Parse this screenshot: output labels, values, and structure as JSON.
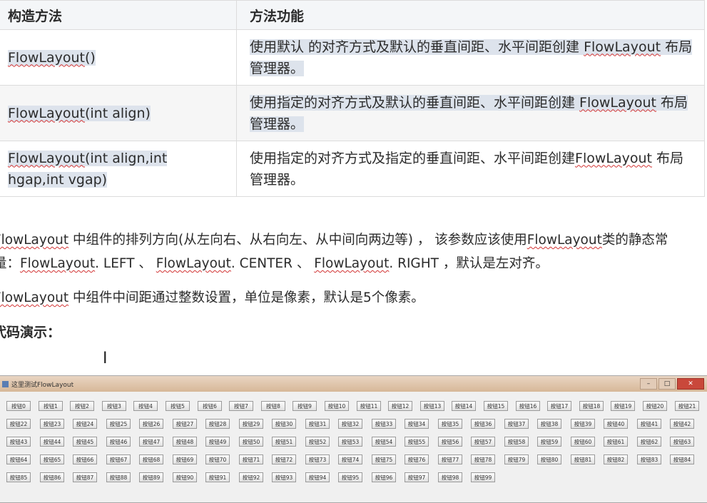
{
  "table": {
    "headers": [
      "构造方法",
      "方法功能"
    ],
    "rows": [
      {
        "method": "FlowLayout()",
        "desc": "使用默认 的对齐方式及默认的垂直间距、水平间距创建 FlowLayout 布局管理器。"
      },
      {
        "method": "FlowLayout(int align)",
        "desc": "使用指定的对齐方式及默认的垂直间距、水平间距创建 FlowLayout 布局管理器。"
      },
      {
        "method": "FlowLayout(int align,int hgap,int vgap)",
        "desc": "使用指定的对齐方式及指定的垂直间距、水平间距创建FlowLayout 布局管理器。"
      }
    ]
  },
  "paragraphs": {
    "p1_line1": "FlowLayout 中组件的排列方向(从左向右、从右向左、从中间向两边等) ， 该参数应该使用FlowLayout类的静态常",
    "p1_line2": "量：FlowLayout. LEFT 、 FlowLayout. CENTER 、 FlowLayout. RIGHT ，默认是左对齐。",
    "p2": "FlowLayout 中组件中间距通过整数设置，单位是像素，默认是5个像素。",
    "code_heading": "代码演示："
  },
  "demo_window": {
    "title": "这里测试FlowLayout",
    "button_prefix": "按钮",
    "button_count": 100,
    "controls": [
      "–",
      "□",
      "✕"
    ]
  }
}
